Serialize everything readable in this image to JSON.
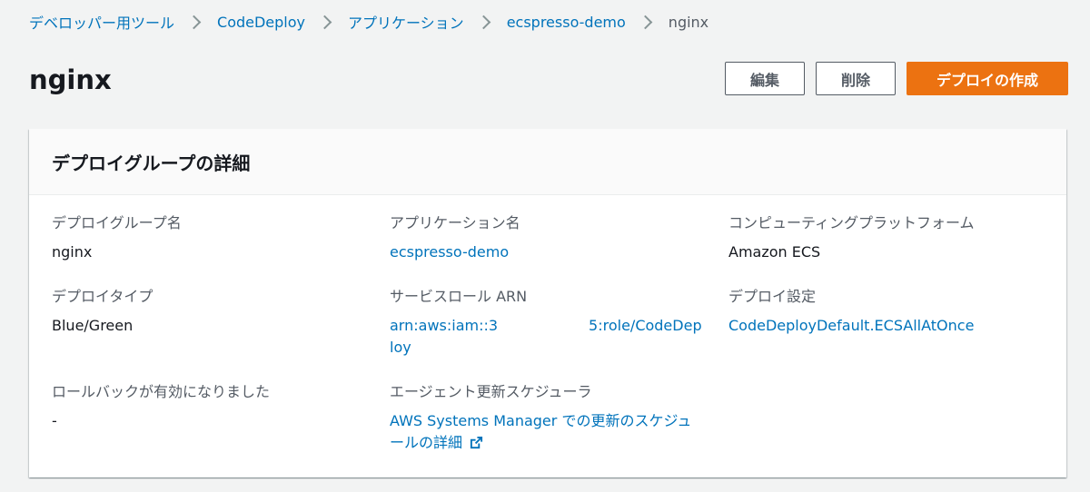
{
  "breadcrumb": {
    "items": [
      "デベロッパー用ツール",
      "CodeDeploy",
      "アプリケーション",
      "ecspresso-demo"
    ],
    "current": "nginx"
  },
  "page": {
    "title": "nginx"
  },
  "actions": {
    "edit_label": "編集",
    "delete_label": "削除",
    "create_label": "デプロイの作成"
  },
  "panel": {
    "title": "デプロイグループの詳細",
    "deployment_group_name": {
      "label": "デプロイグループ名",
      "value": "nginx"
    },
    "application_name": {
      "label": "アプリケーション名",
      "value": "ecspresso-demo"
    },
    "compute_platform": {
      "label": "コンピューティングプラットフォーム",
      "value": "Amazon ECS"
    },
    "deployment_type": {
      "label": "デプロイタイプ",
      "value": "Blue/Green"
    },
    "service_role_arn": {
      "label": "サービスロール ARN",
      "value_start": "arn:aws:iam::3",
      "value_end": "5:role/CodeDeploy"
    },
    "deployment_config": {
      "label": "デプロイ設定",
      "value": "CodeDeployDefault.ECSAllAtOnce"
    },
    "rollback_enabled": {
      "label": "ロールバックが有効になりました",
      "value": "-"
    },
    "agent_scheduler": {
      "label": "エージェント更新スケジューラ",
      "value": "AWS Systems Manager での更新のスケジュールの詳細"
    }
  },
  "colors": {
    "link": "#0073bb",
    "primary_button": "#ec7211",
    "background": "#f2f3f3"
  },
  "icons": {
    "external_link": "external-link-icon",
    "breadcrumb_separator": "chevron-right-icon"
  }
}
